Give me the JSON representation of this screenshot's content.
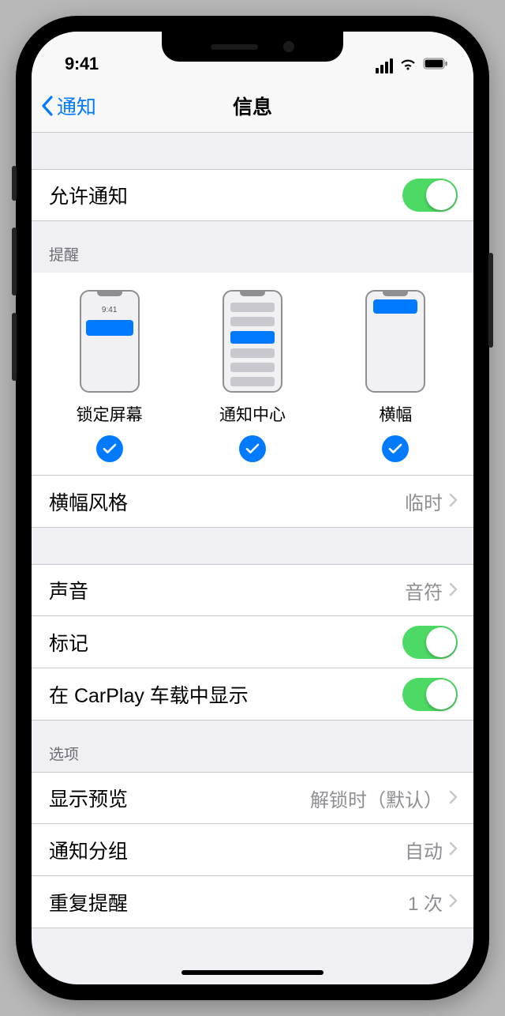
{
  "status": {
    "time": "9:41"
  },
  "nav": {
    "back": "通知",
    "title": "信息"
  },
  "allow": {
    "label": "允许通知",
    "on": true
  },
  "alerts": {
    "header": "提醒",
    "options": [
      {
        "label": "锁定屏幕",
        "checked": true
      },
      {
        "label": "通知中心",
        "checked": true
      },
      {
        "label": "横幅",
        "checked": true
      }
    ],
    "mock_time": "9:41"
  },
  "banner_style": {
    "label": "横幅风格",
    "value": "临时"
  },
  "sounds": {
    "label": "声音",
    "value": "音符"
  },
  "badges": {
    "label": "标记",
    "on": true
  },
  "carplay": {
    "label": "在 CarPlay 车载中显示",
    "on": true
  },
  "options_header": "选项",
  "show_previews": {
    "label": "显示预览",
    "value": "解锁时（默认）"
  },
  "grouping": {
    "label": "通知分组",
    "value": "自动"
  },
  "repeat": {
    "label": "重复提醒",
    "value": "1 次"
  },
  "colors": {
    "accent": "#007aff",
    "switch_on": "#4cd964"
  }
}
